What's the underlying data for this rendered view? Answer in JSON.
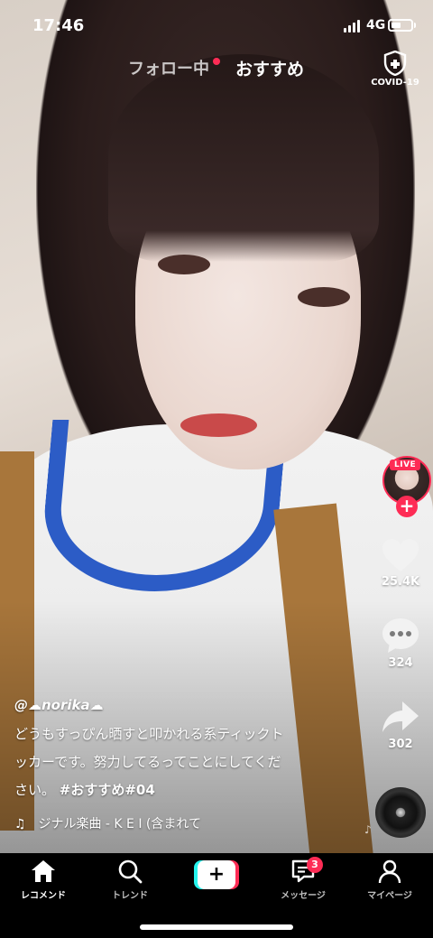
{
  "status_bar": {
    "time": "17:46",
    "network": "4G"
  },
  "top_tabs": {
    "following": "フォロー中",
    "for_you": "おすすめ"
  },
  "covid": {
    "label": "COVID-19"
  },
  "right_rail": {
    "live_badge": "LIVE",
    "likes": "25.4K",
    "comments": "324",
    "shares": "302"
  },
  "caption": {
    "username": "@☁norika☁",
    "description_line1": "どうもすっぴん晒すと叩かれる系ティックト",
    "description_line2": "ッカーです。努力してるってことにしてくだ",
    "description_line3_plain": "さい。",
    "hashtags": "#おすすめ#04"
  },
  "music": {
    "title": "ジナル楽曲 - K E I (含まれて"
  },
  "bottom_nav": {
    "home": "レコメンド",
    "discover": "トレンド",
    "inbox": "メッセージ",
    "inbox_badge": "3",
    "profile": "マイページ"
  },
  "colors": {
    "accent": "#fe2c55",
    "cyan": "#25f4ee",
    "collar_blue": "#2c5cc6"
  }
}
